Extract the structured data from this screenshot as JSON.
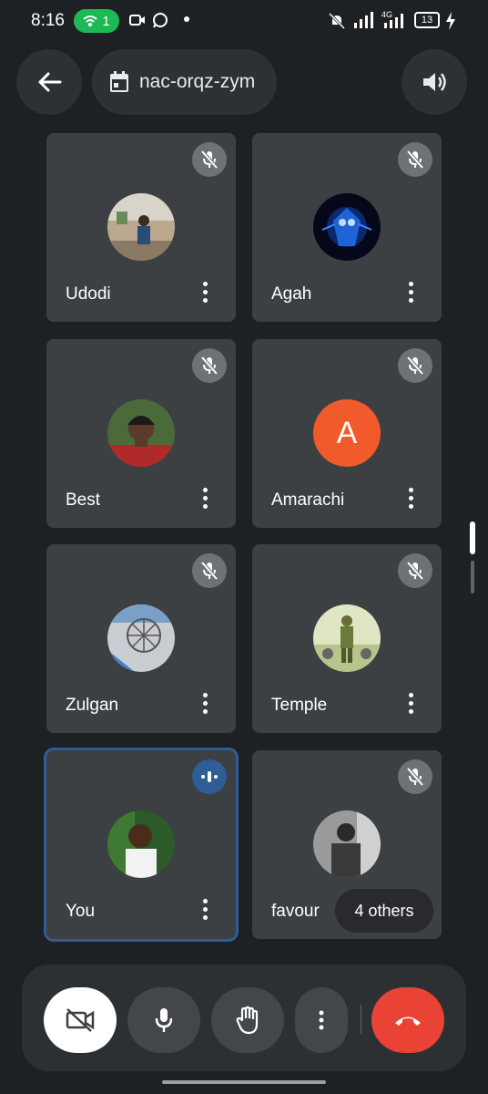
{
  "status": {
    "time": "8:16",
    "hotspot_count": "1",
    "network": "4G",
    "battery": "13"
  },
  "header": {
    "meeting_code": "nac-orqz-zym"
  },
  "participants": [
    {
      "name": "Udodi"
    },
    {
      "name": "Agah"
    },
    {
      "name": "Best"
    },
    {
      "name": "Amarachi",
      "initial": "A"
    },
    {
      "name": "Zulgan"
    },
    {
      "name": "Temple"
    },
    {
      "name": "You"
    },
    {
      "name": "favour"
    }
  ],
  "others_label": "4 others",
  "colors": {
    "background": "#1e2124",
    "tile": "#3c4043",
    "active_border": "#2f5d95",
    "end_call": "#ea4335",
    "hotspot": "#1db954",
    "initial_avatar": "#f15a2b"
  },
  "controls": {
    "camera": "video-off-icon",
    "mic": "mic-icon",
    "hand": "raise-hand-icon",
    "more": "more-vert-icon",
    "end": "call-end-icon"
  }
}
